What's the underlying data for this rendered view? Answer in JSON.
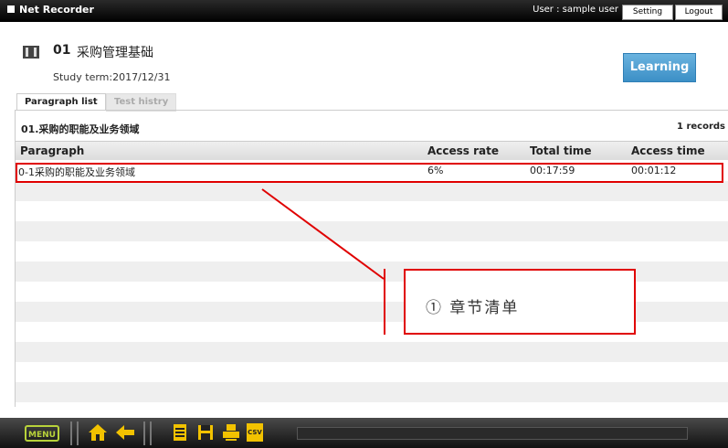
{
  "app": {
    "title": "Net Recorder"
  },
  "user": {
    "label": "User : sample user"
  },
  "top_buttons": {
    "setting": "Setting",
    "logout": "Logout"
  },
  "course": {
    "number": "01",
    "title": "采购管理基础",
    "study_term": "Study term:2017/12/31"
  },
  "learning_button": "Learning",
  "tabs": [
    {
      "label": "Paragraph list",
      "active": true
    },
    {
      "label": "Test histry",
      "active": false
    }
  ],
  "list": {
    "section_title": "01.采购的职能及业务领域",
    "records": "1 records",
    "columns": [
      "Paragraph",
      "Access rate",
      "Total time",
      "Access time"
    ],
    "rows": [
      {
        "paragraph": "0-1采购的职能及业务领域",
        "access_rate": "6%",
        "total_time": "00:17:59",
        "access_time": "00:01:12"
      }
    ]
  },
  "annotation": {
    "text": "① 章节清单"
  },
  "toolbar": {
    "menu_label": "MENU",
    "csv_label": "CSV"
  },
  "colors": {
    "annotation": "#e00000",
    "learning": "#3c8fc6",
    "menu_accent": "#b8d23a",
    "toolbar_yellow": "#f2c200"
  }
}
